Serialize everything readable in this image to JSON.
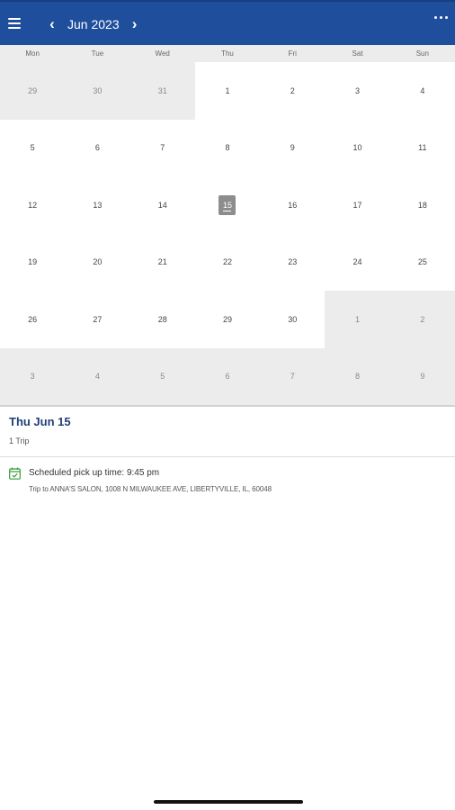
{
  "header": {
    "month_label": "Jun 2023",
    "prev_arrow": "‹",
    "next_arrow": "›"
  },
  "weekdays": [
    "Mon",
    "Tue",
    "Wed",
    "Thu",
    "Fri",
    "Sat",
    "Sun"
  ],
  "calendar": {
    "days": [
      {
        "label": "29",
        "in_month": false
      },
      {
        "label": "30",
        "in_month": false
      },
      {
        "label": "31",
        "in_month": false
      },
      {
        "label": "1",
        "in_month": true
      },
      {
        "label": "2",
        "in_month": true
      },
      {
        "label": "3",
        "in_month": true
      },
      {
        "label": "4",
        "in_month": true
      },
      {
        "label": "5",
        "in_month": true
      },
      {
        "label": "6",
        "in_month": true
      },
      {
        "label": "7",
        "in_month": true
      },
      {
        "label": "8",
        "in_month": true
      },
      {
        "label": "9",
        "in_month": true
      },
      {
        "label": "10",
        "in_month": true
      },
      {
        "label": "11",
        "in_month": true
      },
      {
        "label": "12",
        "in_month": true
      },
      {
        "label": "13",
        "in_month": true
      },
      {
        "label": "14",
        "in_month": true
      },
      {
        "label": "15",
        "in_month": true,
        "selected": true
      },
      {
        "label": "16",
        "in_month": true
      },
      {
        "label": "17",
        "in_month": true
      },
      {
        "label": "18",
        "in_month": true
      },
      {
        "label": "19",
        "in_month": true
      },
      {
        "label": "20",
        "in_month": true
      },
      {
        "label": "21",
        "in_month": true
      },
      {
        "label": "22",
        "in_month": true
      },
      {
        "label": "23",
        "in_month": true
      },
      {
        "label": "24",
        "in_month": true
      },
      {
        "label": "25",
        "in_month": true
      },
      {
        "label": "26",
        "in_month": true
      },
      {
        "label": "27",
        "in_month": true
      },
      {
        "label": "28",
        "in_month": true
      },
      {
        "label": "29",
        "in_month": true
      },
      {
        "label": "30",
        "in_month": true
      },
      {
        "label": "1",
        "in_month": false
      },
      {
        "label": "2",
        "in_month": false
      },
      {
        "label": "3",
        "in_month": false
      },
      {
        "label": "4",
        "in_month": false
      },
      {
        "label": "5",
        "in_month": false
      },
      {
        "label": "6",
        "in_month": false
      },
      {
        "label": "7",
        "in_month": false
      },
      {
        "label": "8",
        "in_month": false
      },
      {
        "label": "9",
        "in_month": false
      }
    ]
  },
  "selected_day": {
    "title": "Thu Jun 15",
    "trip_count": "1 Trip"
  },
  "trips": [
    {
      "icon": "calendar-check-icon",
      "pickup": "Scheduled pick up time: 9:45 pm",
      "destination": "Trip to ANNA'S SALON, 1008 N MILWAUKEE AVE, LIBERTYVILLE, IL, 60048"
    }
  ],
  "colors": {
    "app_bar": "#1f4f9c",
    "outside_month": "#ececec",
    "selected_day": "#8d8d8d",
    "date_title": "#1f3f78",
    "calendar_icon": "#3a9a3a"
  }
}
